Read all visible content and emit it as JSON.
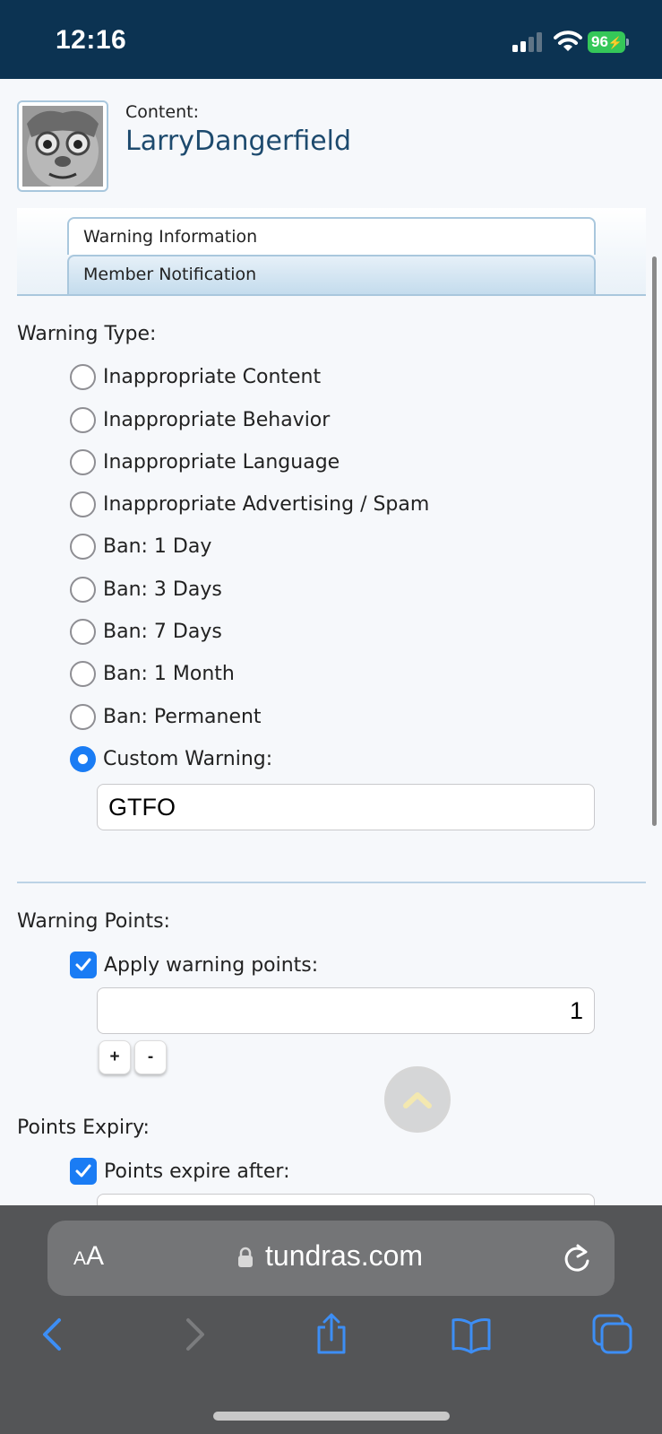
{
  "status_bar": {
    "time": "12:16",
    "battery": "96"
  },
  "header": {
    "content_label": "Content:",
    "username": "LarryDangerfield"
  },
  "tabs": [
    {
      "label": "Warning Information"
    },
    {
      "label": "Member Notification"
    }
  ],
  "warning_type": {
    "label": "Warning Type:",
    "options": [
      {
        "label": "Inappropriate Content",
        "selected": false
      },
      {
        "label": "Inappropriate Behavior",
        "selected": false
      },
      {
        "label": "Inappropriate Language",
        "selected": false
      },
      {
        "label": "Inappropriate Advertising / Spam",
        "selected": false
      },
      {
        "label": "Ban: 1 Day",
        "selected": false
      },
      {
        "label": "Ban: 3 Days",
        "selected": false
      },
      {
        "label": "Ban: 7 Days",
        "selected": false
      },
      {
        "label": "Ban: 1 Month",
        "selected": false
      },
      {
        "label": "Ban: Permanent",
        "selected": false
      },
      {
        "label": "Custom Warning:",
        "selected": true
      }
    ],
    "custom_value": "GTFO"
  },
  "warning_points": {
    "label": "Warning Points:",
    "apply_label": "Apply warning points:",
    "apply_checked": true,
    "value": "1",
    "plus_label": "+",
    "minus_label": "-"
  },
  "points_expiry": {
    "label": "Points Expiry:",
    "expire_label": "Points expire after:",
    "expire_checked": true
  },
  "browser": {
    "aa_small": "A",
    "aa_large": "A",
    "url": "tundras.com"
  },
  "colors": {
    "accent": "#1a7cf4",
    "status_bar": "#0c3352",
    "link": "#1d4a6e",
    "battery": "#35c759",
    "browser_icon": "#3d8ef5"
  },
  "icons": {
    "signal": "signal-bars-icon",
    "wifi": "wifi-icon",
    "lock": "lock-icon",
    "reload": "reload-icon",
    "back": "chevron-left-icon",
    "forward": "chevron-right-icon",
    "share": "share-icon",
    "bookmarks": "book-icon",
    "tabs": "tabs-icon",
    "scroll_top": "chevron-up-icon"
  }
}
